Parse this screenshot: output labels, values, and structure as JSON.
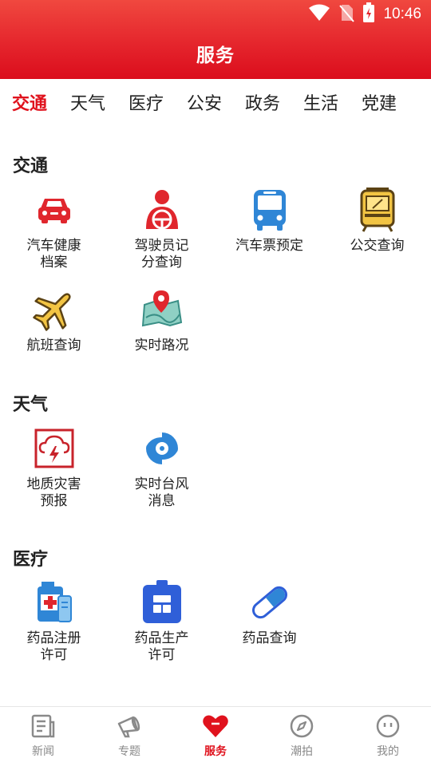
{
  "status_bar": {
    "time": "10:46",
    "icons": [
      "wifi-icon",
      "no-sim-icon",
      "battery-charging-icon"
    ]
  },
  "header": {
    "title": "服务"
  },
  "tabs": [
    {
      "label": "交通",
      "active": true
    },
    {
      "label": "天气"
    },
    {
      "label": "医疗"
    },
    {
      "label": "公安"
    },
    {
      "label": "政务"
    },
    {
      "label": "生活"
    },
    {
      "label": "党建"
    }
  ],
  "sections": [
    {
      "title": "交通",
      "items": [
        {
          "label": "汽车健康档案",
          "icon": "car-icon"
        },
        {
          "label": "驾驶员记分查询",
          "icon": "driver-icon"
        },
        {
          "label": "汽车票预定",
          "icon": "bus-icon"
        },
        {
          "label": "公交查询",
          "icon": "tram-icon"
        },
        {
          "label": "航班查询",
          "icon": "airplane-icon"
        },
        {
          "label": "实时路况",
          "icon": "map-pin-icon"
        }
      ]
    },
    {
      "title": "天气",
      "items": [
        {
          "label": "地质灾害预报",
          "icon": "storm-warning-icon"
        },
        {
          "label": "实时台风消息",
          "icon": "typhoon-icon"
        }
      ]
    },
    {
      "title": "医疗",
      "items": [
        {
          "label": "药品注册许可",
          "icon": "medicine-kit-icon"
        },
        {
          "label": "药品生产许可",
          "icon": "clipboard-icon"
        },
        {
          "label": "药品查询",
          "icon": "pill-icon"
        }
      ]
    }
  ],
  "bottom_nav": [
    {
      "label": "新闻",
      "icon": "news-icon"
    },
    {
      "label": "专题",
      "icon": "megaphone-icon"
    },
    {
      "label": "服务",
      "icon": "heart-icon",
      "active": true
    },
    {
      "label": "潮拍",
      "icon": "compass-icon"
    },
    {
      "label": "我的",
      "icon": "face-icon"
    }
  ],
  "colors": {
    "brand_red": "#e0121d",
    "icon_blue": "#2f86d6",
    "nav_grey": "#8a8a8a"
  }
}
